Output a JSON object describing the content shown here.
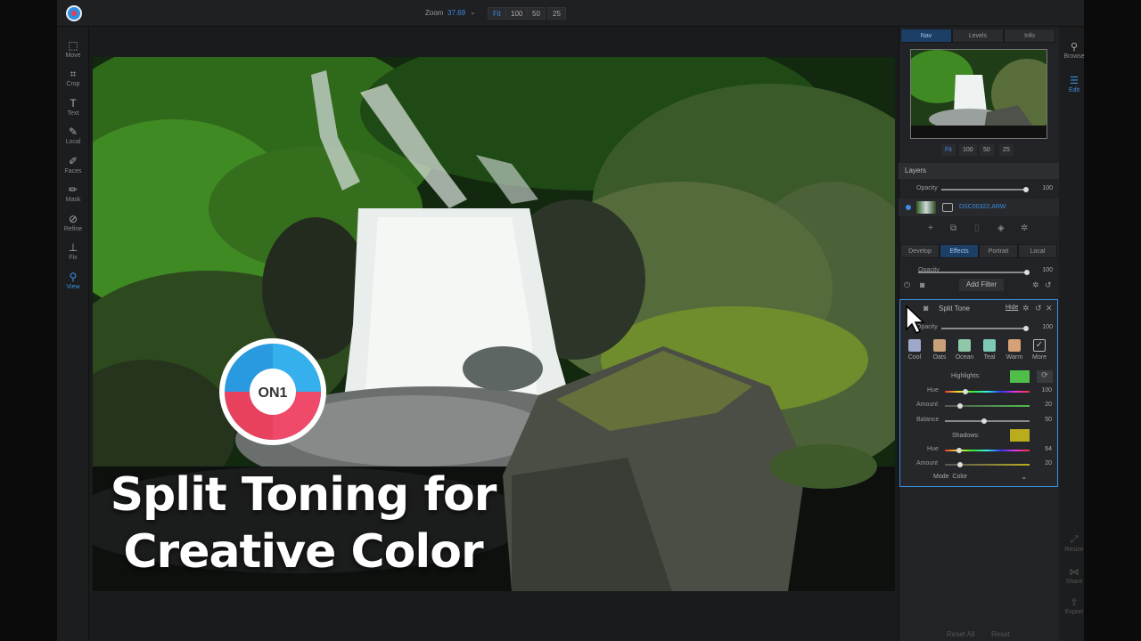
{
  "topbar": {
    "zoom_label": "Zoom",
    "zoom_value": "37.69",
    "zoom_buttons": [
      "Fit",
      "100",
      "50",
      "25"
    ]
  },
  "tools": [
    {
      "label": "Move",
      "icon": "move-icon"
    },
    {
      "label": "Crop",
      "icon": "crop-icon"
    },
    {
      "label": "Text",
      "icon": "text-icon"
    },
    {
      "label": "Local",
      "icon": "brush-icon"
    },
    {
      "label": "Faces",
      "icon": "faces-icon"
    },
    {
      "label": "Mask",
      "icon": "mask-icon"
    },
    {
      "label": "Refine",
      "icon": "refine-icon"
    },
    {
      "label": "Fix",
      "icon": "stamp-icon"
    },
    {
      "label": "View",
      "icon": "magnifier-icon"
    }
  ],
  "panel": {
    "tabs": [
      "Nav",
      "Levels",
      "Info"
    ],
    "nav_zoom": [
      "Fit",
      "100",
      "50",
      "25"
    ],
    "layers_title": "Layers",
    "opacity_label": "Opacity",
    "opacity_value": "100",
    "layer_name": "DSC00322.ARW",
    "effect_tabs": [
      "Develop",
      "Effects",
      "Portrait",
      "Local"
    ],
    "fx_opacity_label": "Opacity",
    "fx_opacity_value": "100",
    "add_filter": "Add Filter"
  },
  "split_tone": {
    "title": "Split Tone",
    "hide": "Hide",
    "opacity_label": "Opacity",
    "opacity_value": "100",
    "presets": [
      {
        "label": "Cool",
        "color": "#9ea9c9"
      },
      {
        "label": "Oats",
        "color": "#c8a07a"
      },
      {
        "label": "Ocean",
        "color": "#8fc8a8"
      },
      {
        "label": "Teal",
        "color": "#7ccab6"
      },
      {
        "label": "Warm",
        "color": "#d6a175"
      },
      {
        "label": "More",
        "color": "#2b2c2f"
      }
    ],
    "highlights_label": "Highlights:",
    "highlights_color": "#4fbf4a",
    "hue_label": "Hue",
    "hue_value": "100",
    "amount_label": "Amount",
    "amount_value": "20",
    "balance_label": "Balance",
    "balance_value": "50",
    "shadows_label": "Shadows:",
    "shadows_color": "#b9ad1e",
    "shadow_hue_label": "Hue",
    "shadow_hue_value": "64",
    "shadow_amount_label": "Amount",
    "shadow_amount_value": "20",
    "mode_label": "Mode",
    "mode_value": "Color"
  },
  "right_strip": [
    {
      "label": "Browse",
      "icon": "browse-icon"
    },
    {
      "label": "Edit",
      "icon": "edit-icon"
    },
    {
      "label": "Resize",
      "icon": "resize-icon"
    },
    {
      "label": "Share",
      "icon": "share-icon"
    },
    {
      "label": "Export",
      "icon": "export-icon"
    }
  ],
  "bottom": {
    "reset_all": "Reset All",
    "reset": "Reset"
  },
  "overlay": {
    "headline_line1": "Split Toning for",
    "headline_line2": "Creative Color",
    "logo_text": "ON1"
  }
}
